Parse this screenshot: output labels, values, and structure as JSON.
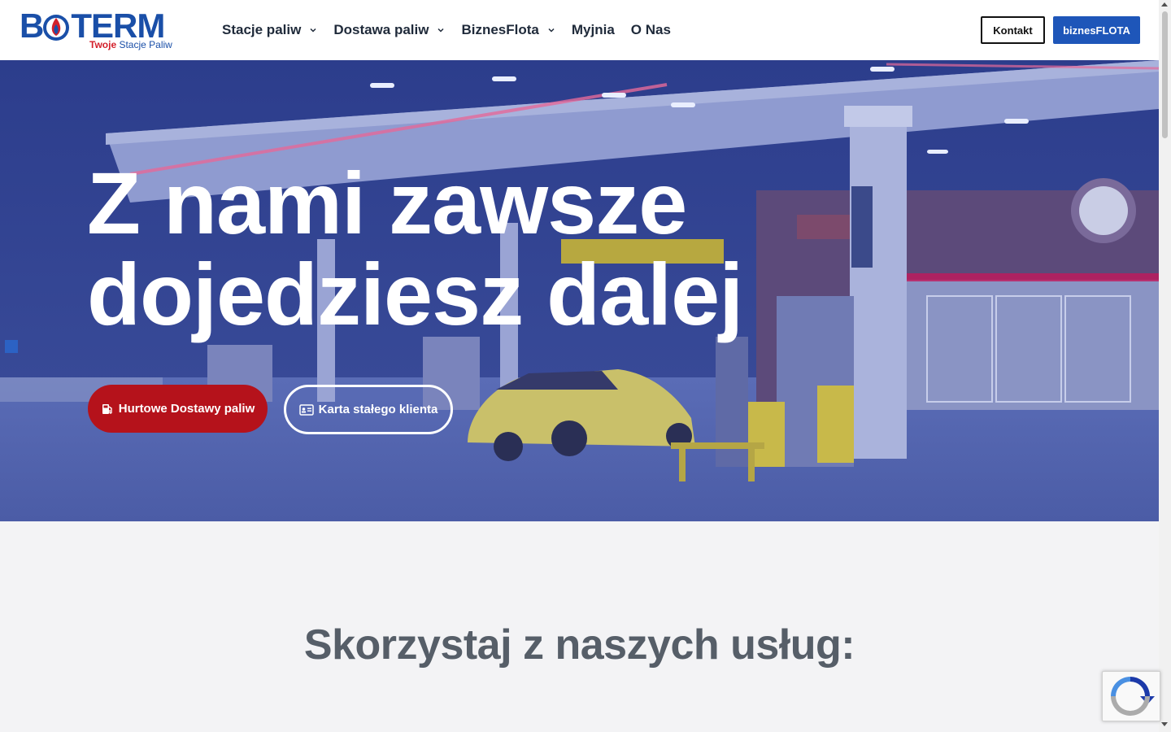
{
  "brand": {
    "logo_text_left": "B",
    "logo_text_right": "TERM",
    "tagline_strong": "Twoje",
    "tagline_rest": " Stacje Paliw",
    "primary_color": "#1e56b9",
    "accent_color": "#b5121b"
  },
  "nav": {
    "items": [
      {
        "label": "Stacje paliw",
        "has_dropdown": true
      },
      {
        "label": "Dostawa paliw",
        "has_dropdown": true
      },
      {
        "label": "BiznesFlota",
        "has_dropdown": true
      },
      {
        "label": "Myjnia",
        "has_dropdown": false
      },
      {
        "label": "O Nas",
        "has_dropdown": false
      }
    ],
    "kontakt_label": "Kontakt",
    "biznes_label": "biznesFLOTA"
  },
  "hero": {
    "title_line1": "Z nami zawsze",
    "title_line2": "dojedziesz dalej",
    "cta_primary": "Hurtowe Dostawy paliw",
    "cta_primary_icon": "fuel-pump-icon",
    "cta_secondary": "Karta stałego klienta",
    "cta_secondary_icon": "id-card-icon"
  },
  "services": {
    "title": "Skorzystaj z naszych usług:"
  }
}
